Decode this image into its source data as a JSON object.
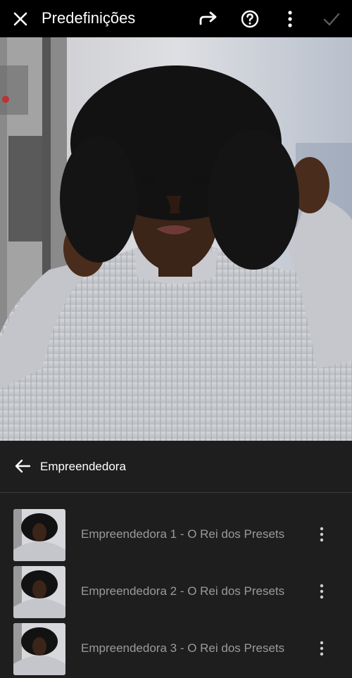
{
  "topbar": {
    "title": "Predefinições",
    "icons": [
      "close-icon",
      "redo-icon",
      "help-icon",
      "more-vertical-icon",
      "check-icon"
    ]
  },
  "panel": {
    "back_icon": "arrow-left-icon",
    "group_label": "Empreendedora"
  },
  "presets": [
    {
      "name": "Empreendedora 1 - O Rei dos Presets"
    },
    {
      "name": "Empreendedora 2 - O Rei dos Presets"
    },
    {
      "name": "Empreendedora 3 - O Rei dos Presets"
    }
  ],
  "colors": {
    "topbar_bg": "#000000",
    "panel_bg": "#1e1e1e",
    "preset_text": "#9a9a9a",
    "check_disabled": "#5a5a5a"
  }
}
